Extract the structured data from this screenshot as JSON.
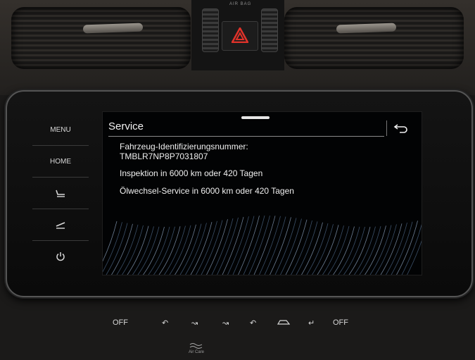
{
  "dashboard": {
    "airbag_label": "AIR BAG",
    "air_care_label": "Air Care"
  },
  "side_menu": {
    "menu_label": "MENU",
    "home_label": "HOME"
  },
  "screen": {
    "title": "Service",
    "vin_label": "Fahrzeug-Identifizierungsnummer:",
    "vin_value": "TMBLR7NP8P7031807",
    "inspection_text": "Inspektion in 6000 km oder 420 Tagen",
    "oil_service_text": "Ölwechsel-Service in 6000 km oder 420 Tagen"
  },
  "climate": {
    "left_off": "OFF",
    "right_off": "OFF"
  },
  "colors": {
    "hazard": "#e0322a",
    "ambient": "#b02ab0",
    "screen_bg": "#020304",
    "text": "#f0f0f0"
  }
}
